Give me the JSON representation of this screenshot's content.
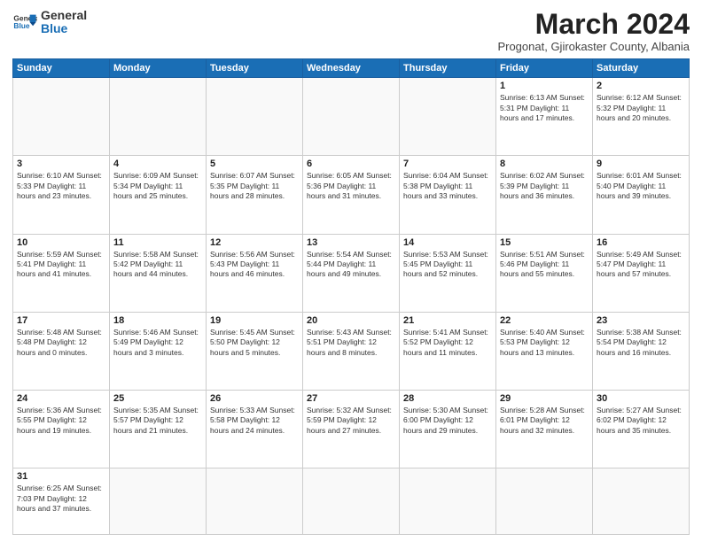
{
  "header": {
    "logo_line1": "General",
    "logo_line2": "Blue",
    "month_year": "March 2024",
    "location": "Progonat, Gjirokaster County, Albania"
  },
  "weekdays": [
    "Sunday",
    "Monday",
    "Tuesday",
    "Wednesday",
    "Thursday",
    "Friday",
    "Saturday"
  ],
  "weeks": [
    [
      {
        "day": "",
        "info": ""
      },
      {
        "day": "",
        "info": ""
      },
      {
        "day": "",
        "info": ""
      },
      {
        "day": "",
        "info": ""
      },
      {
        "day": "",
        "info": ""
      },
      {
        "day": "1",
        "info": "Sunrise: 6:13 AM\nSunset: 5:31 PM\nDaylight: 11 hours\nand 17 minutes."
      },
      {
        "day": "2",
        "info": "Sunrise: 6:12 AM\nSunset: 5:32 PM\nDaylight: 11 hours\nand 20 minutes."
      }
    ],
    [
      {
        "day": "3",
        "info": "Sunrise: 6:10 AM\nSunset: 5:33 PM\nDaylight: 11 hours\nand 23 minutes."
      },
      {
        "day": "4",
        "info": "Sunrise: 6:09 AM\nSunset: 5:34 PM\nDaylight: 11 hours\nand 25 minutes."
      },
      {
        "day": "5",
        "info": "Sunrise: 6:07 AM\nSunset: 5:35 PM\nDaylight: 11 hours\nand 28 minutes."
      },
      {
        "day": "6",
        "info": "Sunrise: 6:05 AM\nSunset: 5:36 PM\nDaylight: 11 hours\nand 31 minutes."
      },
      {
        "day": "7",
        "info": "Sunrise: 6:04 AM\nSunset: 5:38 PM\nDaylight: 11 hours\nand 33 minutes."
      },
      {
        "day": "8",
        "info": "Sunrise: 6:02 AM\nSunset: 5:39 PM\nDaylight: 11 hours\nand 36 minutes."
      },
      {
        "day": "9",
        "info": "Sunrise: 6:01 AM\nSunset: 5:40 PM\nDaylight: 11 hours\nand 39 minutes."
      }
    ],
    [
      {
        "day": "10",
        "info": "Sunrise: 5:59 AM\nSunset: 5:41 PM\nDaylight: 11 hours\nand 41 minutes."
      },
      {
        "day": "11",
        "info": "Sunrise: 5:58 AM\nSunset: 5:42 PM\nDaylight: 11 hours\nand 44 minutes."
      },
      {
        "day": "12",
        "info": "Sunrise: 5:56 AM\nSunset: 5:43 PM\nDaylight: 11 hours\nand 46 minutes."
      },
      {
        "day": "13",
        "info": "Sunrise: 5:54 AM\nSunset: 5:44 PM\nDaylight: 11 hours\nand 49 minutes."
      },
      {
        "day": "14",
        "info": "Sunrise: 5:53 AM\nSunset: 5:45 PM\nDaylight: 11 hours\nand 52 minutes."
      },
      {
        "day": "15",
        "info": "Sunrise: 5:51 AM\nSunset: 5:46 PM\nDaylight: 11 hours\nand 55 minutes."
      },
      {
        "day": "16",
        "info": "Sunrise: 5:49 AM\nSunset: 5:47 PM\nDaylight: 11 hours\nand 57 minutes."
      }
    ],
    [
      {
        "day": "17",
        "info": "Sunrise: 5:48 AM\nSunset: 5:48 PM\nDaylight: 12 hours\nand 0 minutes."
      },
      {
        "day": "18",
        "info": "Sunrise: 5:46 AM\nSunset: 5:49 PM\nDaylight: 12 hours\nand 3 minutes."
      },
      {
        "day": "19",
        "info": "Sunrise: 5:45 AM\nSunset: 5:50 PM\nDaylight: 12 hours\nand 5 minutes."
      },
      {
        "day": "20",
        "info": "Sunrise: 5:43 AM\nSunset: 5:51 PM\nDaylight: 12 hours\nand 8 minutes."
      },
      {
        "day": "21",
        "info": "Sunrise: 5:41 AM\nSunset: 5:52 PM\nDaylight: 12 hours\nand 11 minutes."
      },
      {
        "day": "22",
        "info": "Sunrise: 5:40 AM\nSunset: 5:53 PM\nDaylight: 12 hours\nand 13 minutes."
      },
      {
        "day": "23",
        "info": "Sunrise: 5:38 AM\nSunset: 5:54 PM\nDaylight: 12 hours\nand 16 minutes."
      }
    ],
    [
      {
        "day": "24",
        "info": "Sunrise: 5:36 AM\nSunset: 5:55 PM\nDaylight: 12 hours\nand 19 minutes."
      },
      {
        "day": "25",
        "info": "Sunrise: 5:35 AM\nSunset: 5:57 PM\nDaylight: 12 hours\nand 21 minutes."
      },
      {
        "day": "26",
        "info": "Sunrise: 5:33 AM\nSunset: 5:58 PM\nDaylight: 12 hours\nand 24 minutes."
      },
      {
        "day": "27",
        "info": "Sunrise: 5:32 AM\nSunset: 5:59 PM\nDaylight: 12 hours\nand 27 minutes."
      },
      {
        "day": "28",
        "info": "Sunrise: 5:30 AM\nSunset: 6:00 PM\nDaylight: 12 hours\nand 29 minutes."
      },
      {
        "day": "29",
        "info": "Sunrise: 5:28 AM\nSunset: 6:01 PM\nDaylight: 12 hours\nand 32 minutes."
      },
      {
        "day": "30",
        "info": "Sunrise: 5:27 AM\nSunset: 6:02 PM\nDaylight: 12 hours\nand 35 minutes."
      }
    ],
    [
      {
        "day": "31",
        "info": "Sunrise: 6:25 AM\nSunset: 7:03 PM\nDaylight: 12 hours\nand 37 minutes."
      },
      {
        "day": "",
        "info": ""
      },
      {
        "day": "",
        "info": ""
      },
      {
        "day": "",
        "info": ""
      },
      {
        "day": "",
        "info": ""
      },
      {
        "day": "",
        "info": ""
      },
      {
        "day": "",
        "info": ""
      }
    ]
  ]
}
